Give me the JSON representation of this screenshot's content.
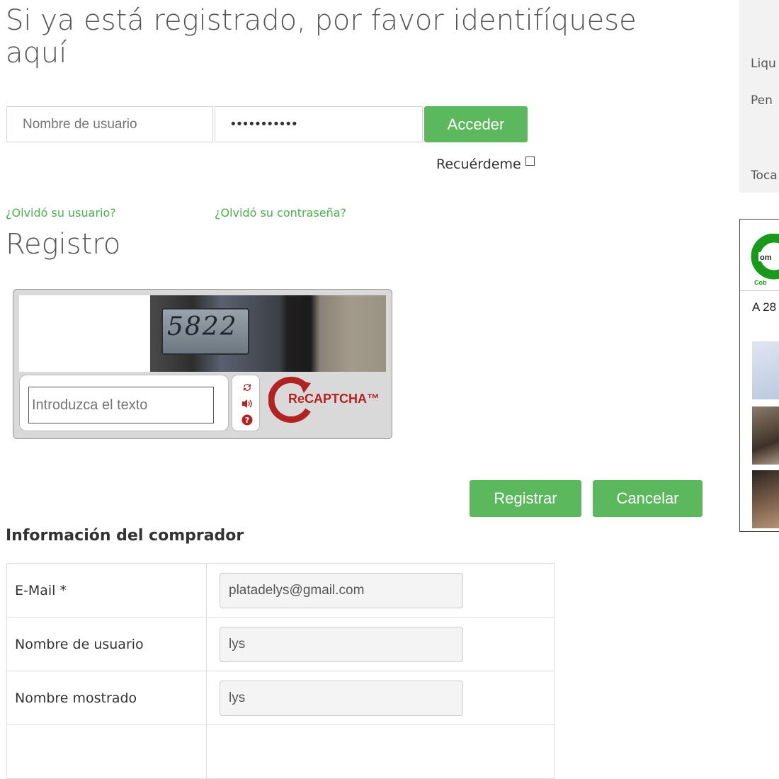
{
  "login": {
    "heading": "Si ya está registrado, por favor identifíquese aquí",
    "username_placeholder": "Nombre de usuario",
    "password_value": "•••••••••••",
    "submit_label": "Acceder",
    "remember_label": "Recuérdeme",
    "forgot_username": "¿Olvidó su usuario?",
    "forgot_password": "¿Olvidó su contraseña?"
  },
  "register": {
    "heading": "Registro",
    "captcha": {
      "challenge_text": "5822",
      "input_placeholder": "Introduzca el texto",
      "logo_text": "ReCAPTCHA™",
      "icons": [
        "refresh-icon",
        "audio-icon",
        "help-icon"
      ]
    },
    "register_label": "Registrar",
    "cancel_label": "Cancelar"
  },
  "buyer": {
    "heading": "Información del comprador",
    "rows": [
      {
        "label": "E-Mail *",
        "value": "platadelys@gmail.com"
      },
      {
        "label": "Nombre de usuario",
        "value": "lys"
      },
      {
        "label": "Nombre mostrado",
        "value": "lys"
      }
    ]
  },
  "sidebar": {
    "summary_labels": [
      "Liqu",
      "Pen",
      "Toca"
    ],
    "social_count_text": "A 28"
  },
  "colors": {
    "accent_green": "#5cb85c",
    "link_green": "#4cae4c",
    "recaptcha_red": "#b22222"
  }
}
